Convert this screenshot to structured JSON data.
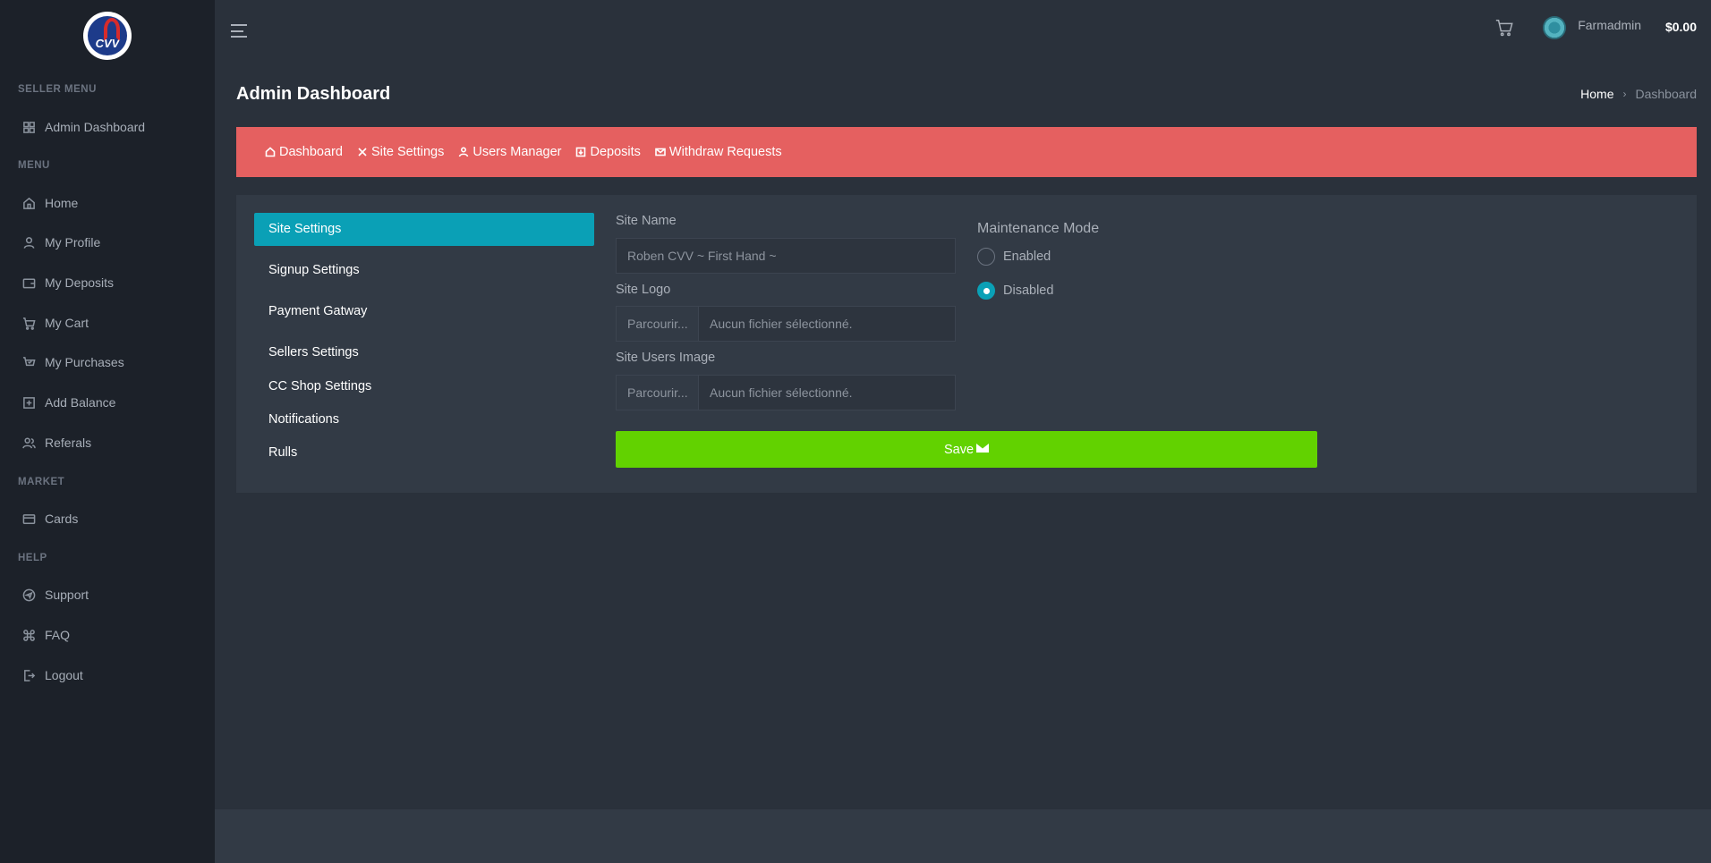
{
  "sidebar": {
    "sections": {
      "seller_menu": "SELLER MENU",
      "menu": "MENU",
      "market": "MARKET",
      "help": "HELP"
    },
    "items": {
      "admin_dashboard": "Admin Dashboard",
      "home": "Home",
      "my_profile": "My Profile",
      "my_deposits": "My Deposits",
      "my_cart": "My Cart",
      "my_purchases": "My Purchases",
      "add_balance": "Add Balance",
      "referals": "Referals",
      "cards": "Cards",
      "support": "Support",
      "faq": "FAQ",
      "logout": "Logout"
    },
    "logo_text": "CVV"
  },
  "topbar": {
    "username": "Farmadmin",
    "balance": "$0.00"
  },
  "page": {
    "title": "Admin Dashboard",
    "breadcrumb": {
      "home": "Home",
      "current": "Dashboard"
    }
  },
  "admin_nav": {
    "dashboard": "Dashboard",
    "site_settings": "Site Settings",
    "users_manager": "Users Manager",
    "deposits": "Deposits",
    "withdraw_requests": "Withdraw Requests"
  },
  "settings_tabs": {
    "site_settings": "Site Settings",
    "signup_settings": "Signup Settings",
    "payment_gatway": "Payment Gatway",
    "sellers_settings": "Sellers Settings",
    "cc_shop_settings": "CC Shop Settings",
    "notifications": "Notifications",
    "rulls": "Rulls"
  },
  "form": {
    "site_name_label": "Site Name",
    "site_name_value": "Roben CVV ~ First Hand ~",
    "site_logo_label": "Site Logo",
    "site_users_image_label": "Site Users Image",
    "browse_label": "Parcourir...",
    "no_file_label": "Aucun fichier sélectionné.",
    "maintenance_title": "Maintenance Mode",
    "enabled_label": "Enabled",
    "disabled_label": "Disabled",
    "selected_mode": "Disabled",
    "save_label": "Save"
  },
  "colors": {
    "accent_teal": "#0aa0b6",
    "nav_red": "#e56060",
    "save_green": "#62d200"
  }
}
